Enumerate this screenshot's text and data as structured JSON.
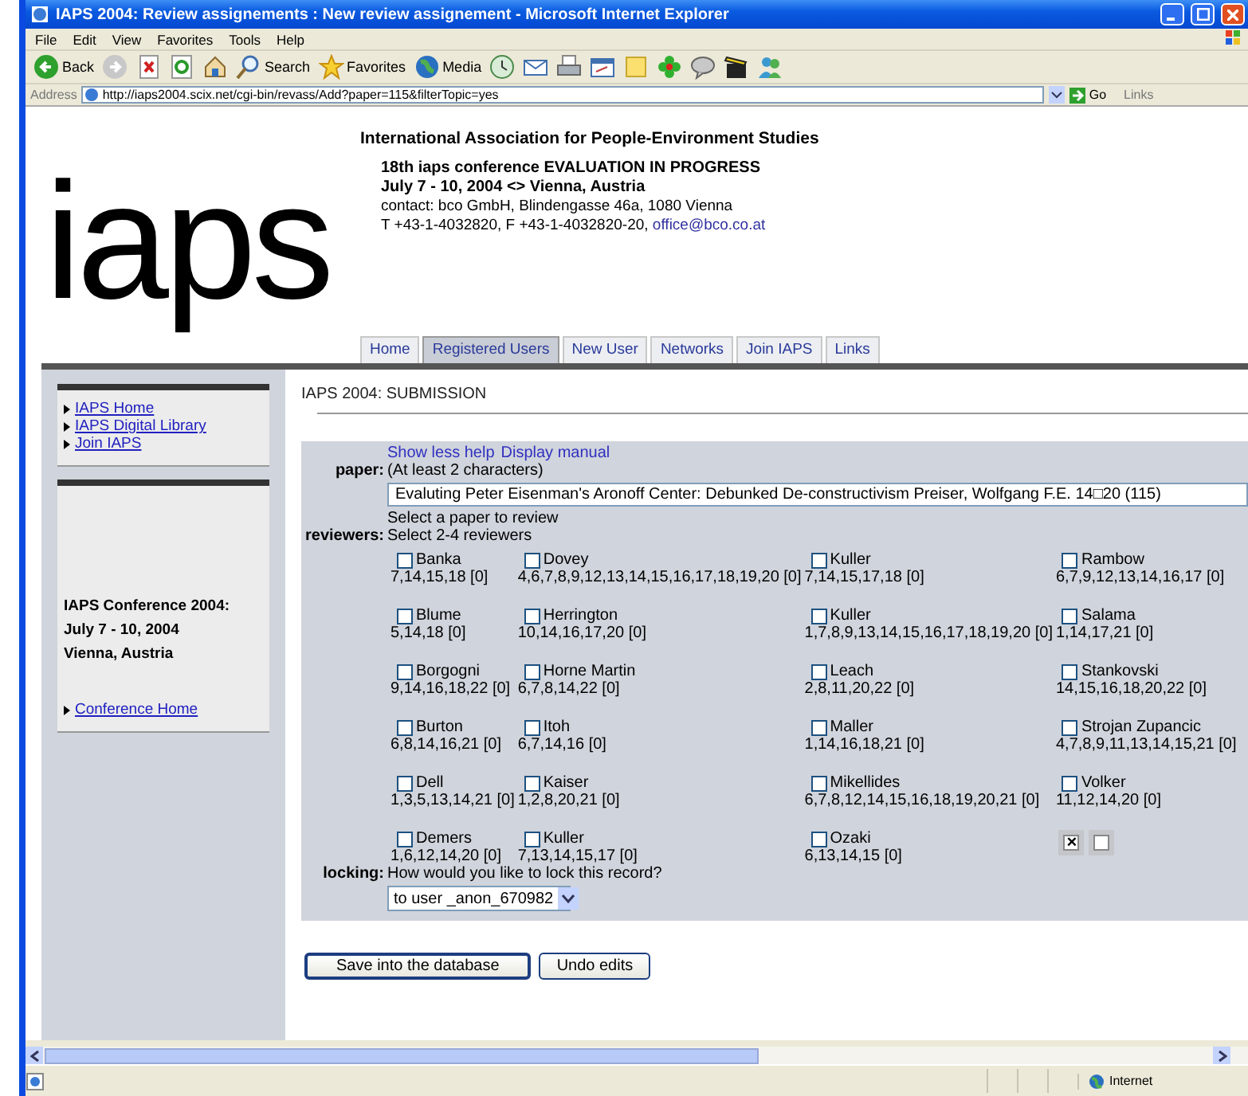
{
  "window": {
    "title": "IAPS 2004: Review assignements : New review assignement - Microsoft Internet Explorer"
  },
  "menu": [
    "File",
    "Edit",
    "View",
    "Favorites",
    "Tools",
    "Help"
  ],
  "toolbar": [
    {
      "kind": "back",
      "label": "Back"
    },
    {
      "kind": "forward"
    },
    {
      "kind": "stop"
    },
    {
      "kind": "refresh"
    },
    {
      "kind": "home"
    },
    {
      "kind": "search",
      "label": "Search"
    },
    {
      "kind": "favorites",
      "label": "Favorites"
    },
    {
      "kind": "media",
      "label": "Media"
    },
    {
      "kind": "history"
    },
    {
      "kind": "mail"
    },
    {
      "kind": "print"
    },
    {
      "kind": "edit"
    },
    {
      "kind": "note"
    },
    {
      "kind": "flower"
    },
    {
      "kind": "chat"
    },
    {
      "kind": "clapper"
    },
    {
      "kind": "people"
    }
  ],
  "address_bar": {
    "label": "Address",
    "url": "http://iaps2004.scix.net/cgi-bin/revass/Add?paper=115&filterTopic=yes",
    "go": "Go",
    "links": "Links"
  },
  "header": {
    "logo": "iaps",
    "org": "International Association for People-Environment Studies",
    "conference": "18th iaps conference EVALUATION IN PROGRESS",
    "dates": "July 7 - 10, 2004 <> Vienna, Austria",
    "contact": "contact: bco GmbH, Blindengasse 46a, 1080 Vienna",
    "phone": "T +43-1-4032820, F +43-1-4032820-20,",
    "email": "office@bco.co.at"
  },
  "tabs": [
    {
      "label": "Home",
      "selected": false
    },
    {
      "label": "Registered Users",
      "selected": true
    },
    {
      "label": "New User",
      "selected": false
    },
    {
      "label": "Networks",
      "selected": false
    },
    {
      "label": "Join IAPS",
      "selected": false
    },
    {
      "label": "Links",
      "selected": false
    }
  ],
  "sidebar": {
    "links": [
      "IAPS Home",
      "IAPS Digital Library",
      "Join IAPS"
    ],
    "conference": [
      "IAPS Conference 2004:",
      "July 7 - 10, 2004",
      "Vienna, Austria"
    ],
    "conference_links": [
      "Conference Home"
    ]
  },
  "page_title": "IAPS 2004: SUBMISSION",
  "form": {
    "help_links": [
      "Show less help",
      "Display manual"
    ],
    "paper": {
      "label": "paper:",
      "hint": "(At least 2 characters)",
      "value": "Evaluting Peter Eisenman's Aronoff Center: Debunked De-constructivism Preiser, Wolfgang F.E. 14□20 (115)",
      "note": "Select a paper to review"
    },
    "reviewers": {
      "label": "reviewers:",
      "hint": "Select 2-4 reviewers",
      "items": [
        {
          "name": "Banka",
          "topics": "7,14,15,18 [0]",
          "checked": false
        },
        {
          "name": "Dovey",
          "topics": "4,6,7,8,9,12,13,14,15,16,17,18,19,20 [0]",
          "checked": false
        },
        {
          "name": "Kuller",
          "topics": "7,14,15,17,18 [0]",
          "checked": false
        },
        {
          "name": "Rambow",
          "topics": "6,7,9,12,13,14,16,17 [0]",
          "checked": false
        },
        {
          "name": "Blume",
          "topics": "5,14,18 [0]",
          "checked": false
        },
        {
          "name": "Herrington",
          "topics": "10,14,16,17,20 [0]",
          "checked": false
        },
        {
          "name": "Kuller",
          "topics": "1,7,8,9,13,14,15,16,17,18,19,20 [0]",
          "checked": false
        },
        {
          "name": "Salama",
          "topics": "1,14,17,21 [0]",
          "checked": false
        },
        {
          "name": "Borgogni",
          "topics": "9,14,16,18,22 [0]",
          "checked": false
        },
        {
          "name": "Horne Martin",
          "topics": "6,7,8,14,22 [0]",
          "checked": false
        },
        {
          "name": "Leach",
          "topics": "2,8,11,20,22 [0]",
          "checked": false
        },
        {
          "name": "Stankovski",
          "topics": "14,15,16,18,20,22 [0]",
          "checked": false
        },
        {
          "name": "Burton",
          "topics": "6,8,14,16,21 [0]",
          "checked": false
        },
        {
          "name": "Itoh",
          "topics": "6,7,14,16 [0]",
          "checked": false
        },
        {
          "name": "Maller",
          "topics": "1,14,16,18,21 [0]",
          "checked": false
        },
        {
          "name": "Strojan Zupancic",
          "topics": "4,7,8,9,11,13,14,15,21 [0]",
          "checked": false
        },
        {
          "name": "Dell",
          "topics": "1,3,5,13,14,21 [0]",
          "checked": false
        },
        {
          "name": "Kaiser",
          "topics": "1,2,8,20,21 [0]",
          "checked": false
        },
        {
          "name": "Mikellides",
          "topics": "6,7,8,12,14,15,16,18,19,20,21 [0]",
          "checked": false
        },
        {
          "name": "Volker",
          "topics": "11,12,14,20 [0]",
          "checked": false
        },
        {
          "name": "Demers",
          "topics": "1,6,12,14,20 [0]",
          "checked": false
        },
        {
          "name": "Kuller",
          "topics": "7,13,14,15,17 [0]",
          "checked": false
        },
        {
          "name": "Ozaki",
          "topics": "6,13,14,15 [0]",
          "checked": false
        }
      ],
      "selection_buttons": [
        {
          "kind": "clear",
          "label": "×"
        },
        {
          "kind": "blank"
        }
      ]
    },
    "locking": {
      "label": "locking:",
      "hint": "How would you like to lock this record?",
      "value": "to user _anon_670982"
    }
  },
  "buttons": [
    "Save into the database",
    "Undo edits"
  ],
  "status_bar": {
    "zone": "Internet"
  }
}
